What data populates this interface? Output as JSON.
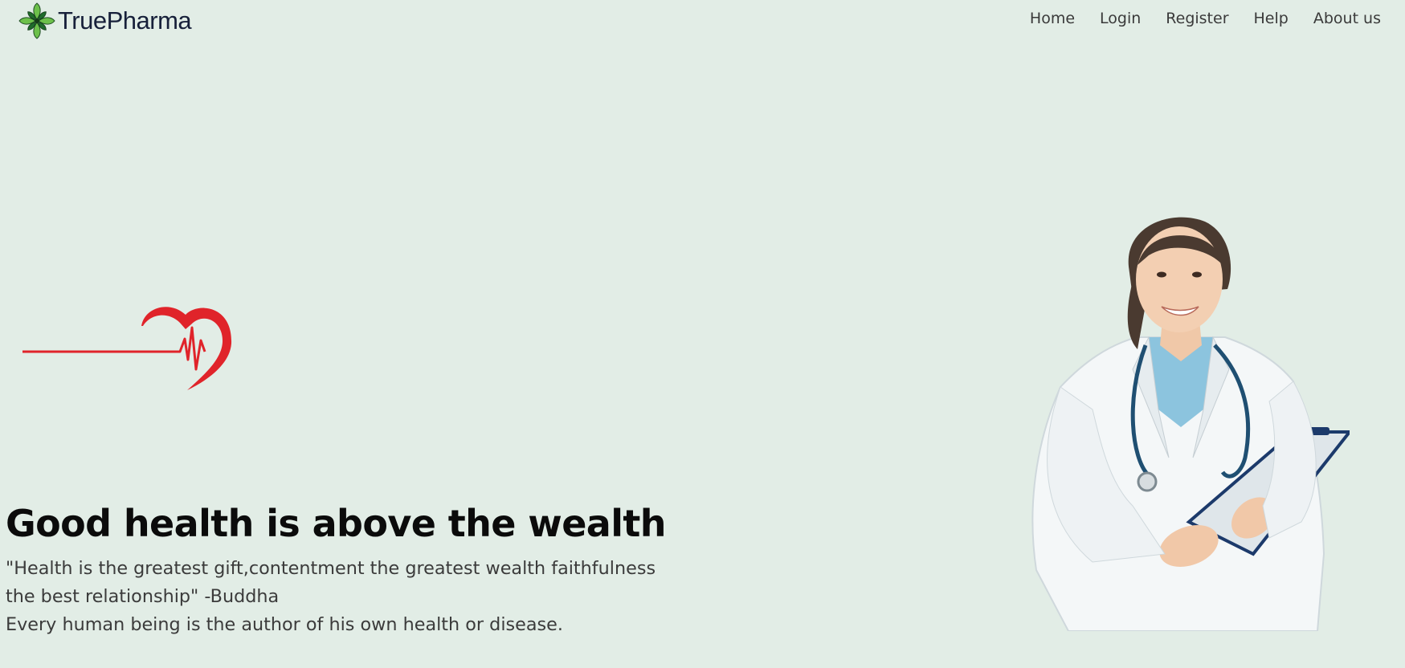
{
  "brand": {
    "name": "TruePharma",
    "logo_icon": "leaf-flower-logo-icon",
    "logo_colors": {
      "leaf_dark": "#1f6b2c",
      "leaf_light": "#6cc04a"
    }
  },
  "nav": {
    "items": [
      {
        "label": "Home"
      },
      {
        "label": "Login"
      },
      {
        "label": "Register"
      },
      {
        "label": "Help"
      },
      {
        "label": "About us"
      }
    ]
  },
  "hero": {
    "title": "Good health is above the wealth",
    "quote_line1": "\"Health is the greatest gift,contentment the greatest wealth faithfulness",
    "quote_line2": "the best relationship\" -Buddha",
    "tagline": "Every human being is the author of his own health or disease.",
    "heartbeat_icon": "heartbeat-heart-icon",
    "heartbeat_color": "#e0242a",
    "image": "smiling-doctor-with-clipboard-illustration"
  },
  "colors": {
    "background": "#e2ede6",
    "text_dark": "#0b0b0b",
    "text_muted": "#3b3b3b",
    "brand_text": "#17203a"
  }
}
